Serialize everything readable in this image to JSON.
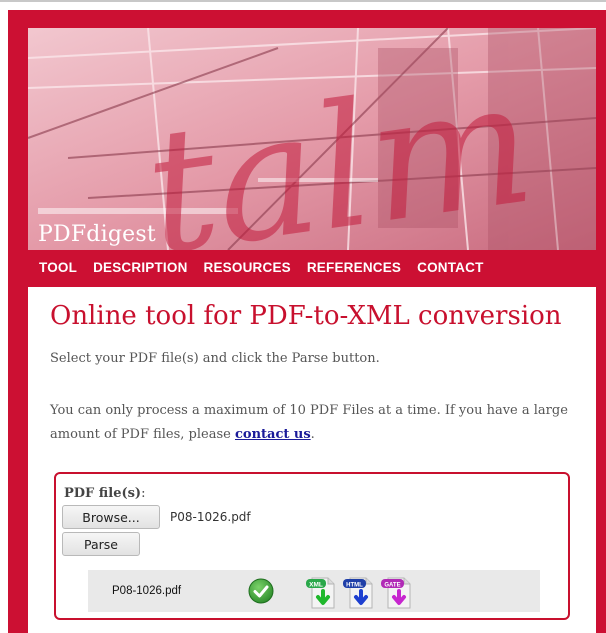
{
  "site": {
    "title": "PDFdigest",
    "banner_watermark": "talm"
  },
  "nav": [
    "TOOL",
    "DESCRIPTION",
    "RESOURCES",
    "REFERENCES",
    "CONTACT"
  ],
  "main": {
    "heading": "Online tool for PDF-to-XML conversion",
    "instruction": "Select your PDF file(s) and click the Parse button.",
    "limit_text": "You can only process a maximum of 10 PDF Files at a time. If you have a large amount of PDF files, please ",
    "contact_link": "contact us",
    "limit_suffix": "."
  },
  "form": {
    "label": "PDF file(s)",
    "label_suffix": ":",
    "browse_label": "Browse...",
    "selected_file": "P08-1026.pdf",
    "parse_label": "Parse"
  },
  "result": {
    "filename": "P08-1026.pdf",
    "status_icon": "check-icon",
    "downloads": [
      {
        "label": "XML",
        "badge_color": "#2aa84a",
        "arrow_color": "#1fb82c"
      },
      {
        "label": "HTML",
        "badge_color": "#1f3fa8",
        "arrow_color": "#1d3fd0"
      },
      {
        "label": "GATE",
        "badge_color": "#b12bb6",
        "arrow_color": "#c726cf"
      }
    ]
  },
  "colors": {
    "frame": "#cc1033",
    "accent": "#c8102e",
    "link": "#1a1a99"
  }
}
